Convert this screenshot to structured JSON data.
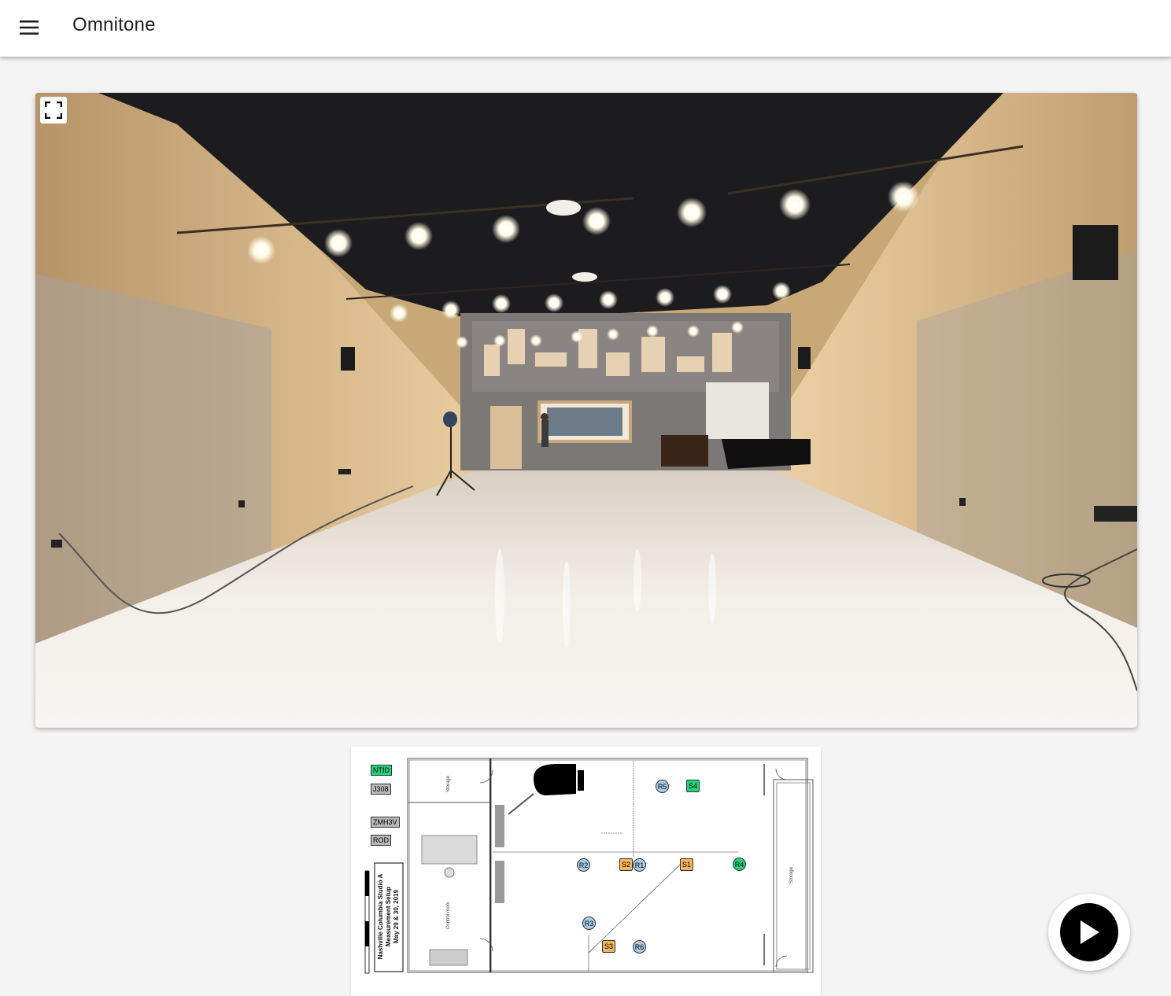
{
  "app": {
    "title": "Omnitone",
    "menu_icon": "menu-icon"
  },
  "viewer": {
    "fullscreen_icon": "fullscreen-icon",
    "scene": "studio-panorama"
  },
  "floorplan": {
    "legend_tags": [
      {
        "label": "NTID",
        "color": "#21d37a"
      },
      {
        "label": "J308",
        "color": "#b8b8b8"
      },
      {
        "label": "ZMH3V",
        "color": "#b8b8b8"
      },
      {
        "label": "ROD",
        "color": "#b8b8b8"
      }
    ],
    "title_lines": [
      "Nashville Columbia Studio A",
      "Measurement Setup",
      "May 29 & 30, 2019"
    ],
    "rooms": {
      "storage_top": "Storage",
      "control_room": "Control room",
      "storage_right": "Storage"
    },
    "receivers": [
      {
        "label": "R1",
        "color": "#a9cbe8"
      },
      {
        "label": "R2",
        "color": "#a9cbe8"
      },
      {
        "label": "R3",
        "color": "#a9cbe8"
      },
      {
        "label": "R4",
        "color": "#21d37a"
      },
      {
        "label": "R5",
        "color": "#a9cbe8"
      },
      {
        "label": "R6",
        "color": "#a9cbe8"
      }
    ],
    "sources": [
      {
        "label": "S1",
        "color": "#f4b45a"
      },
      {
        "label": "S2",
        "color": "#f4b45a"
      },
      {
        "label": "S3",
        "color": "#f4b45a"
      },
      {
        "label": "S4",
        "color": "#21d37a"
      }
    ]
  },
  "controls": {
    "play_icon": "play-icon"
  }
}
